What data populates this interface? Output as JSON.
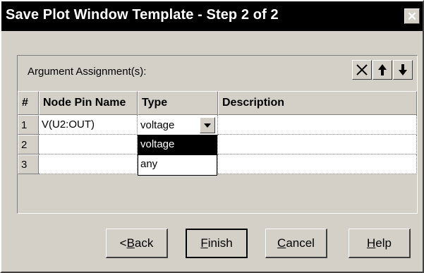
{
  "window": {
    "title": "Save Plot Window Template - Step 2 of 2",
    "close_icon": "close-icon"
  },
  "toolbar": {
    "label": "Argument Assignment(s):",
    "buttons": [
      {
        "name": "delete",
        "icon": "delete-x-icon"
      },
      {
        "name": "move-up",
        "icon": "arrow-up-icon"
      },
      {
        "name": "move-down",
        "icon": "arrow-down-icon"
      }
    ]
  },
  "table": {
    "columns": [
      "#",
      "Node Pin Name",
      "Type",
      "Description"
    ],
    "rows": [
      {
        "num": "1",
        "node_pin_name": "V(U2:OUT)",
        "type": "voltage",
        "description": ""
      },
      {
        "num": "2",
        "node_pin_name": "",
        "type": "",
        "description": ""
      },
      {
        "num": "3",
        "node_pin_name": "",
        "type": "",
        "description": ""
      }
    ],
    "type_combo": {
      "value": "voltage",
      "options": [
        "voltage",
        "any"
      ],
      "highlighted": "voltage"
    }
  },
  "buttons": {
    "back": {
      "label": "Back",
      "mnemonic": "B"
    },
    "finish": {
      "label": "Finish",
      "mnemonic": "F"
    },
    "cancel": {
      "label": "Cancel",
      "mnemonic": "C"
    },
    "help": {
      "label": "Help",
      "mnemonic": "H"
    }
  }
}
